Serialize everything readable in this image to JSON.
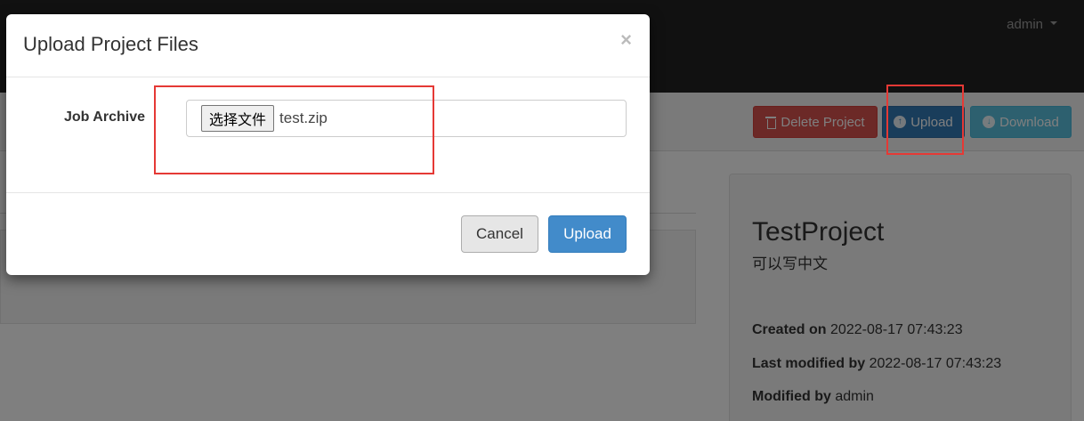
{
  "navbar": {
    "user_label": "admin"
  },
  "toolbar": {
    "delete_label": "Delete Project",
    "upload_label": "Upload",
    "download_label": "Download"
  },
  "project": {
    "name": "TestProject",
    "description": "可以写中文",
    "created_on_label": "Created on",
    "created_on_value": "2022-08-17 07:43:23",
    "last_modified_by_label": "Last modified by",
    "last_modified_by_value": "2022-08-17 07:43:23",
    "modified_by_label": "Modified by",
    "modified_by_value": "admin"
  },
  "modal": {
    "title": "Upload Project Files",
    "close_glyph": "×",
    "field_label": "Job Archive",
    "file_button_label": "选择文件",
    "file_name": "test.zip",
    "cancel_label": "Cancel",
    "upload_label": "Upload"
  },
  "colors": {
    "danger": "#d9534f",
    "primary": "#337ab7",
    "info": "#5bc0de",
    "highlight": "#e53935",
    "navbar": "#222222"
  },
  "icons": {
    "delete": "trash-icon",
    "upload": "upload-circle-icon",
    "download": "download-circle-icon",
    "close": "close-icon",
    "user_menu": "caret-down-icon"
  }
}
